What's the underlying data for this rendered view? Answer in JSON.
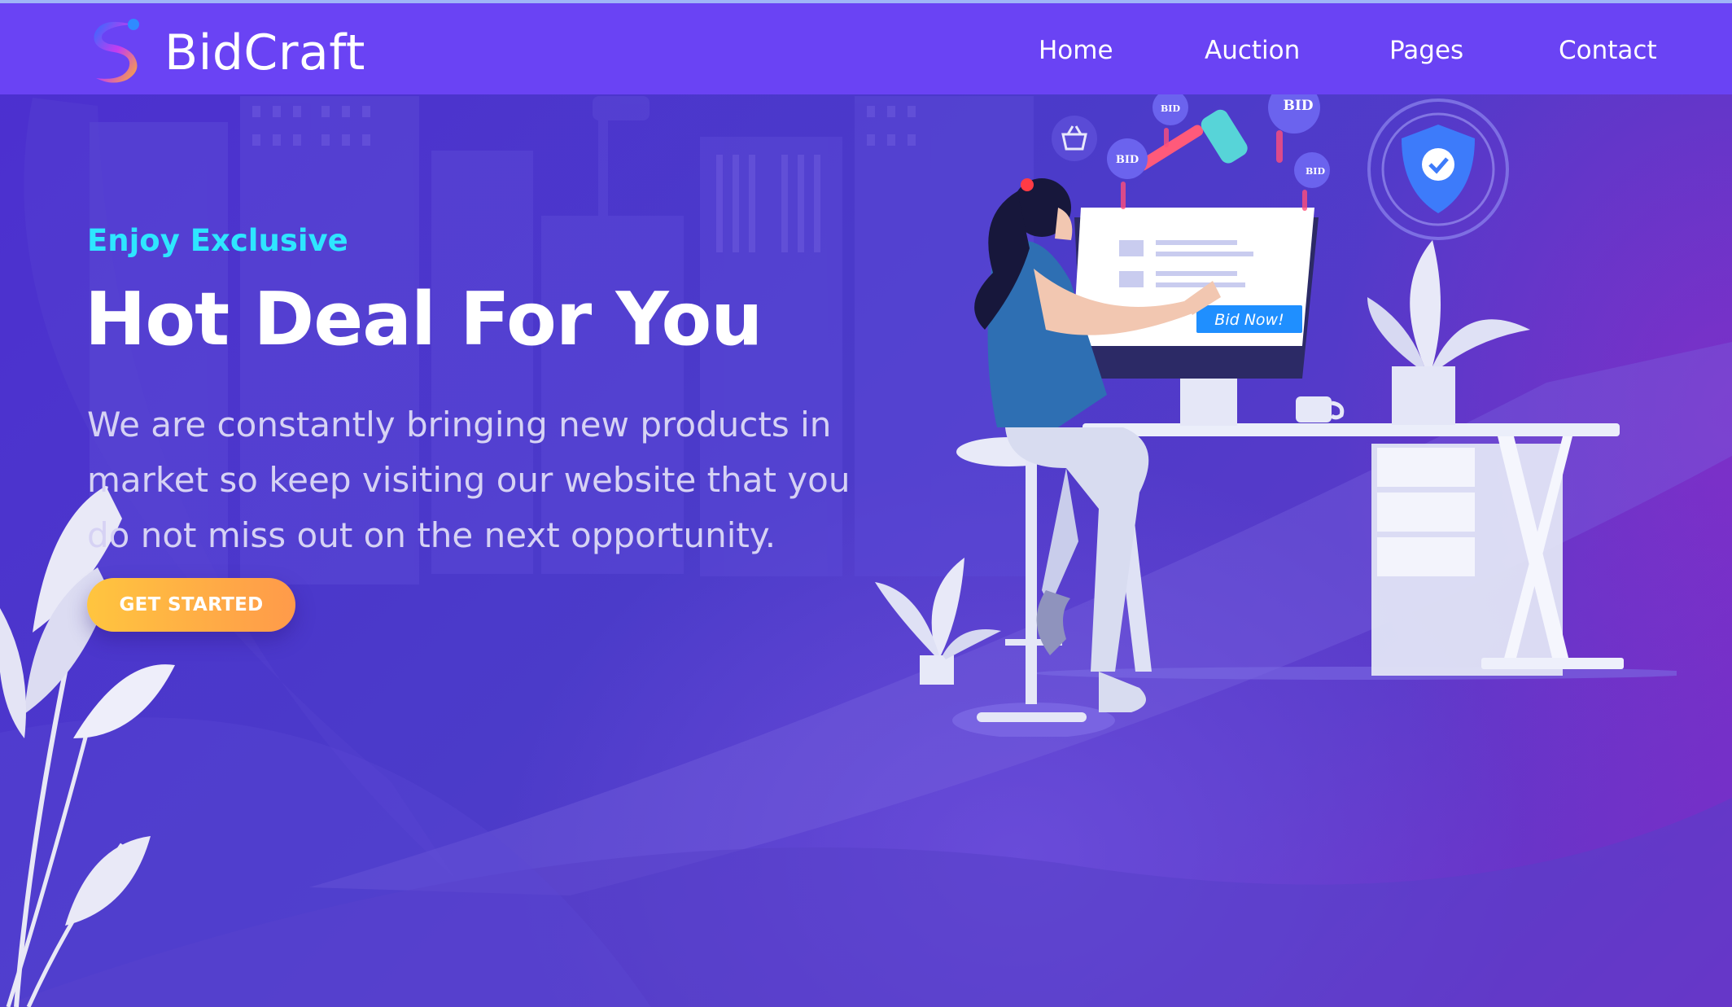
{
  "brand": {
    "name": "BidCraft",
    "logo_icon": "brand-logo-icon"
  },
  "nav": {
    "items": [
      "Home",
      "Auction",
      "Pages",
      "Contact"
    ]
  },
  "hero": {
    "eyebrow": "Enjoy Exclusive",
    "title": "Hot Deal For You",
    "description": "We are constantly bringing new products in market so keep visiting our website that you do not miss out on the next opportunity.",
    "cta_label": "GET STARTED"
  },
  "illustration": {
    "bid_badges": [
      "BID",
      "BID",
      "BID",
      "BID"
    ],
    "screen_button": "Bid Now!",
    "icons": [
      "basket-icon",
      "gavel-icon",
      "shield-check-icon",
      "bid-coin-icon"
    ]
  },
  "colors": {
    "topbar": "#6a43f4",
    "accent_cyan": "#2ee6ff",
    "cta_start": "#ffc53f",
    "cta_end": "#ff9a4a",
    "bid_now_button": "#1f8fff"
  }
}
